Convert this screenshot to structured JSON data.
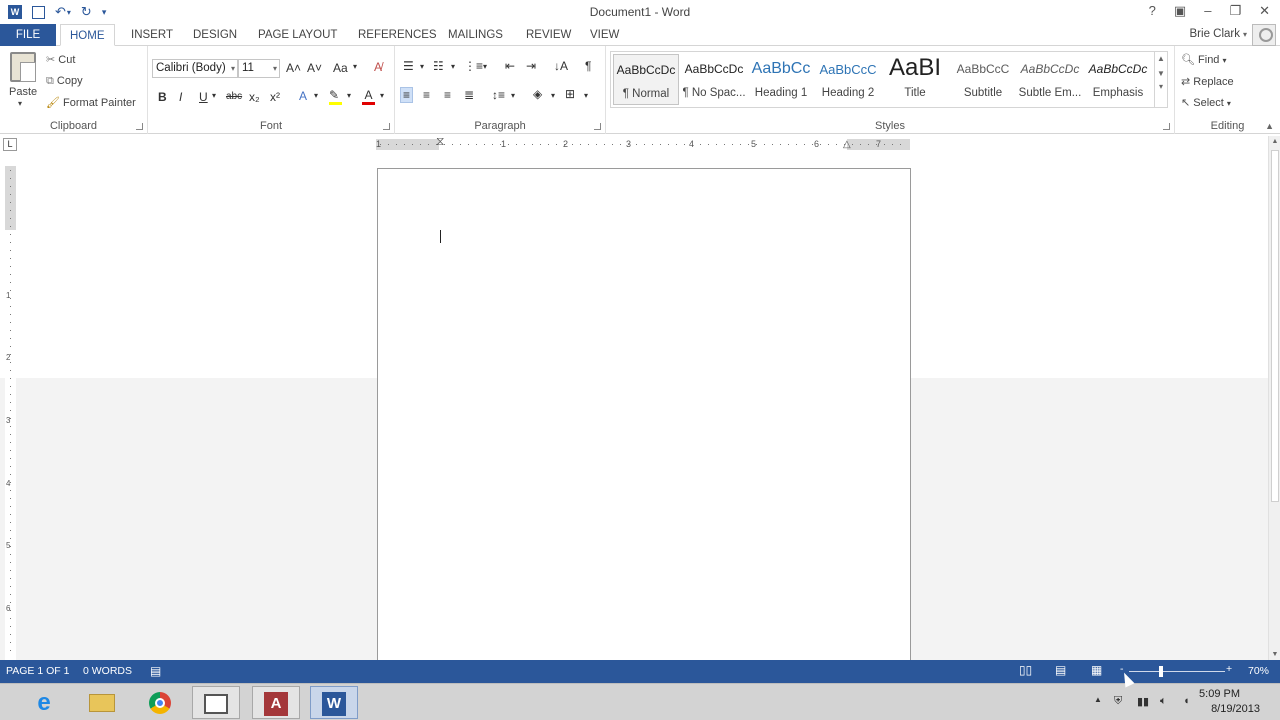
{
  "window": {
    "title": "Document1 - Word"
  },
  "qat": {
    "icons": [
      "word-icon",
      "save-icon",
      "undo-icon",
      "redo-icon",
      "customize-icon"
    ]
  },
  "user": {
    "name": "Brie Clark"
  },
  "tabs": [
    {
      "label": "FILE"
    },
    {
      "label": "HOME"
    },
    {
      "label": "INSERT"
    },
    {
      "label": "DESIGN"
    },
    {
      "label": "PAGE LAYOUT"
    },
    {
      "label": "REFERENCES"
    },
    {
      "label": "MAILINGS"
    },
    {
      "label": "REVIEW"
    },
    {
      "label": "VIEW"
    }
  ],
  "clipboard": {
    "label": "Clipboard",
    "paste": "Paste",
    "cut": "Cut",
    "copy": "Copy",
    "format_painter": "Format Painter"
  },
  "font": {
    "label": "Font",
    "family": "Calibri (Body)",
    "size": "11",
    "bold": "B",
    "italic": "I",
    "underline": "U",
    "strikethrough": "abc",
    "subscript": "x₂",
    "superscript": "x²",
    "grow": "A˄",
    "shrink": "A˅",
    "change_case": "Aa"
  },
  "paragraph": {
    "label": "Paragraph"
  },
  "styles": {
    "label": "Styles",
    "items": [
      {
        "sample": "AaBbCcDc",
        "name": "¶ Normal"
      },
      {
        "sample": "AaBbCcDc",
        "name": "¶ No Spac..."
      },
      {
        "sample": "AaBbCc",
        "name": "Heading 1"
      },
      {
        "sample": "AaBbCcC",
        "name": "Heading 2"
      },
      {
        "sample": "AaBI",
        "name": "Title"
      },
      {
        "sample": "AaBbCcC",
        "name": "Subtitle"
      },
      {
        "sample": "AaBbCcDc",
        "name": "Subtle Em..."
      },
      {
        "sample": "AaBbCcDc",
        "name": "Emphasis"
      }
    ]
  },
  "editing": {
    "label": "Editing",
    "find": "Find",
    "replace": "Replace",
    "select": "Select"
  },
  "ruler": {
    "corner": "L",
    "numbers": [
      "1",
      "1",
      "2",
      "3",
      "4",
      "5",
      "6",
      "7"
    ]
  },
  "status": {
    "page": "PAGE 1 OF 1",
    "words": "0 WORDS",
    "zoom": "70%",
    "zoom_minus": "-",
    "zoom_plus": "+"
  },
  "taskbar": {
    "time": "5:09 PM",
    "date": "8/19/2013",
    "apps": [
      "ie-icon",
      "explorer-icon",
      "chrome-icon",
      "window-icon",
      "access-icon",
      "word-icon"
    ]
  }
}
